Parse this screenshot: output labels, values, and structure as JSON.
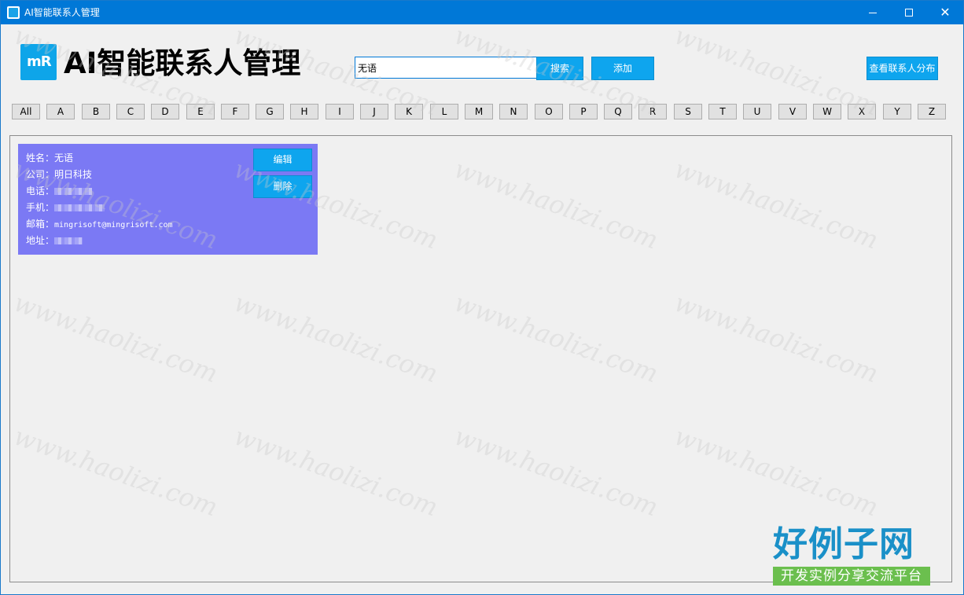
{
  "window": {
    "title": "AI智能联系人管理",
    "controls": {
      "minimize": "—",
      "maximize": "☐",
      "close": "✕"
    }
  },
  "header": {
    "logo_text": "mR",
    "title": "AI智能联系人管理",
    "search_value": "无语",
    "search_button": "搜索",
    "add_button": "添加",
    "distribution_button": "查看联系人分布"
  },
  "letters": [
    "All",
    "A",
    "B",
    "C",
    "D",
    "E",
    "F",
    "G",
    "H",
    "I",
    "J",
    "K",
    "L",
    "M",
    "N",
    "O",
    "P",
    "Q",
    "R",
    "S",
    "T",
    "U",
    "V",
    "W",
    "X",
    "Y",
    "Z"
  ],
  "contact": {
    "name_label": "姓名：",
    "name": "无语",
    "company_label": "公司：",
    "company": "明日科技",
    "phone_label": "电话：",
    "mobile_label": "手机：",
    "email_label": "邮箱：",
    "email": "mingrisoft@mingrisoft.com",
    "address_label": "地址：",
    "edit_button": "编辑",
    "delete_button": "删除"
  },
  "watermark": {
    "text": "www.haolizi.com",
    "brand_top": "好例子网",
    "brand_bottom": "开发实例分享交流平台"
  },
  "colors": {
    "titlebar": "#0078d7",
    "accent_button": "#0ea5ee",
    "card_background": "#7b79f4",
    "brand_blue": "#1a90c8",
    "brand_green": "#6bbf4e"
  }
}
